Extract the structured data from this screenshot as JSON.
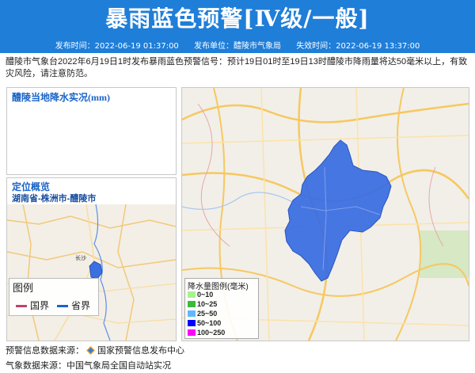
{
  "header": {
    "title": "暴雨蓝色预警[Ⅳ级/一般]",
    "publish_time": "发布时间：2022-06-19 01:37:00",
    "publisher": "发布单位：醴陵市气象局",
    "expire_time": "失效时间：2022-06-19 13:37:00"
  },
  "notice": "醴陵市气象台2022年6月19日1时发布暴雨蓝色预警信号：预计19日01时至19日13时醴陵市降雨量将达50毫米以上，有致灾风险，请注意防范。",
  "rain_panel": {
    "title": "醴陵当地降水实况(mm)"
  },
  "location_panel": {
    "title": "定位概览",
    "region": "湖南省-株洲市-醴陵市",
    "city_label": "长沙",
    "legend": {
      "title": "图例",
      "national": "国界",
      "provincial": "省界"
    },
    "colors": {
      "national": "#c0436e",
      "provincial": "#1c63c9"
    }
  },
  "rain_legend": {
    "title": "降水量图例(毫米)",
    "items": [
      {
        "label": "0~10",
        "color": "#a6f28f"
      },
      {
        "label": "10~25",
        "color": "#3db93d"
      },
      {
        "label": "25~50",
        "color": "#61b8ff"
      },
      {
        "label": "50~100",
        "color": "#0000ff"
      },
      {
        "label": "100~250",
        "color": "#fa00fa"
      }
    ]
  },
  "colors": {
    "accent": "#1f7ed8",
    "warning_area": "#3c6fe0"
  },
  "footer": {
    "source_label": "预警信息数据来源：",
    "source_org": "国家预警信息发布中心",
    "obs_label": "气象数据来源：",
    "obs_org": "中国气象局全国自动站实况"
  }
}
